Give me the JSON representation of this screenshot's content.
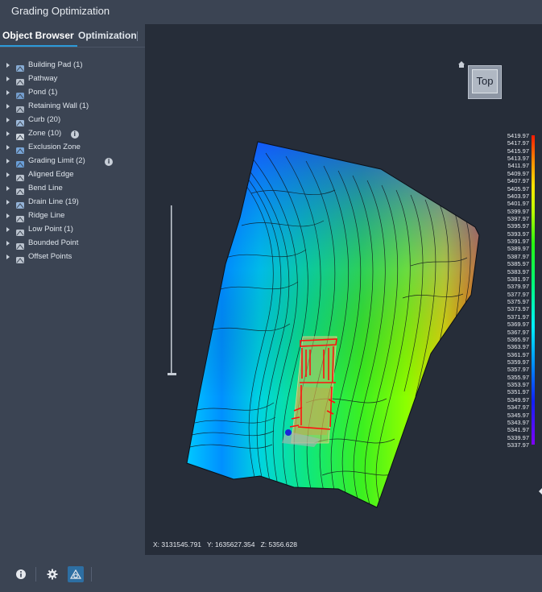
{
  "window": {
    "title": "Grading Optimization"
  },
  "tabs": [
    {
      "label": "Object Browser",
      "active": true
    },
    {
      "label": "Optimization",
      "active": false
    }
  ],
  "tree": [
    {
      "label": "Building Pad (1)",
      "icon": "building-pad-icon"
    },
    {
      "label": "Pathway",
      "icon": "pathway-icon"
    },
    {
      "label": "Pond (1)",
      "icon": "pond-icon"
    },
    {
      "label": "Retaining Wall (1)",
      "icon": "retaining-wall-icon"
    },
    {
      "label": "Curb (20)",
      "icon": "curb-icon"
    },
    {
      "label": "Zone (10)",
      "icon": "zone-icon",
      "info": true
    },
    {
      "label": "Exclusion Zone",
      "icon": "exclusion-zone-icon"
    },
    {
      "label": "Grading Limit (2)",
      "icon": "grading-limit-icon",
      "info": true
    },
    {
      "label": "Aligned Edge",
      "icon": "aligned-edge-icon"
    },
    {
      "label": "Bend Line",
      "icon": "bend-line-icon"
    },
    {
      "label": "Drain Line (19)",
      "icon": "drain-line-icon"
    },
    {
      "label": "Ridge Line",
      "icon": "ridge-line-icon"
    },
    {
      "label": "Low Point (1)",
      "icon": "low-point-icon"
    },
    {
      "label": "Bounded Point",
      "icon": "bounded-point-icon"
    },
    {
      "label": "Offset Points",
      "icon": "offset-points-icon"
    }
  ],
  "viewcube": {
    "label": "Top",
    "home_icon": "home-icon"
  },
  "legend": {
    "values": [
      "5419.97",
      "5417.97",
      "5415.97",
      "5413.97",
      "5411.97",
      "5409.97",
      "5407.97",
      "5405.97",
      "5403.97",
      "5401.97",
      "5399.97",
      "5397.97",
      "5395.97",
      "5393.97",
      "5391.97",
      "5389.97",
      "5387.97",
      "5385.97",
      "5383.97",
      "5381.97",
      "5379.97",
      "5377.97",
      "5375.97",
      "5373.97",
      "5371.97",
      "5369.97",
      "5367.97",
      "5365.97",
      "5363.97",
      "5361.97",
      "5359.97",
      "5357.97",
      "5355.97",
      "5353.97",
      "5351.97",
      "5349.97",
      "5347.97",
      "5345.97",
      "5343.97",
      "5341.97",
      "5339.97",
      "5337.97"
    ],
    "colors": [
      "#ff1a00",
      "#ff5a00",
      "#ff9a00",
      "#ffd400",
      "#e4ff00",
      "#8cff00",
      "#17ff2a",
      "#00ff8a",
      "#00fff0",
      "#00b4ff",
      "#0050ff",
      "#1a00ff",
      "#7a00ff"
    ]
  },
  "coords": {
    "text": "X: 3131545.791   Y: 1635627.354   Z: 5356.628"
  },
  "bottombar": {
    "buttons": [
      "info-icon",
      "settings-icon",
      "site-view-icon"
    ]
  }
}
